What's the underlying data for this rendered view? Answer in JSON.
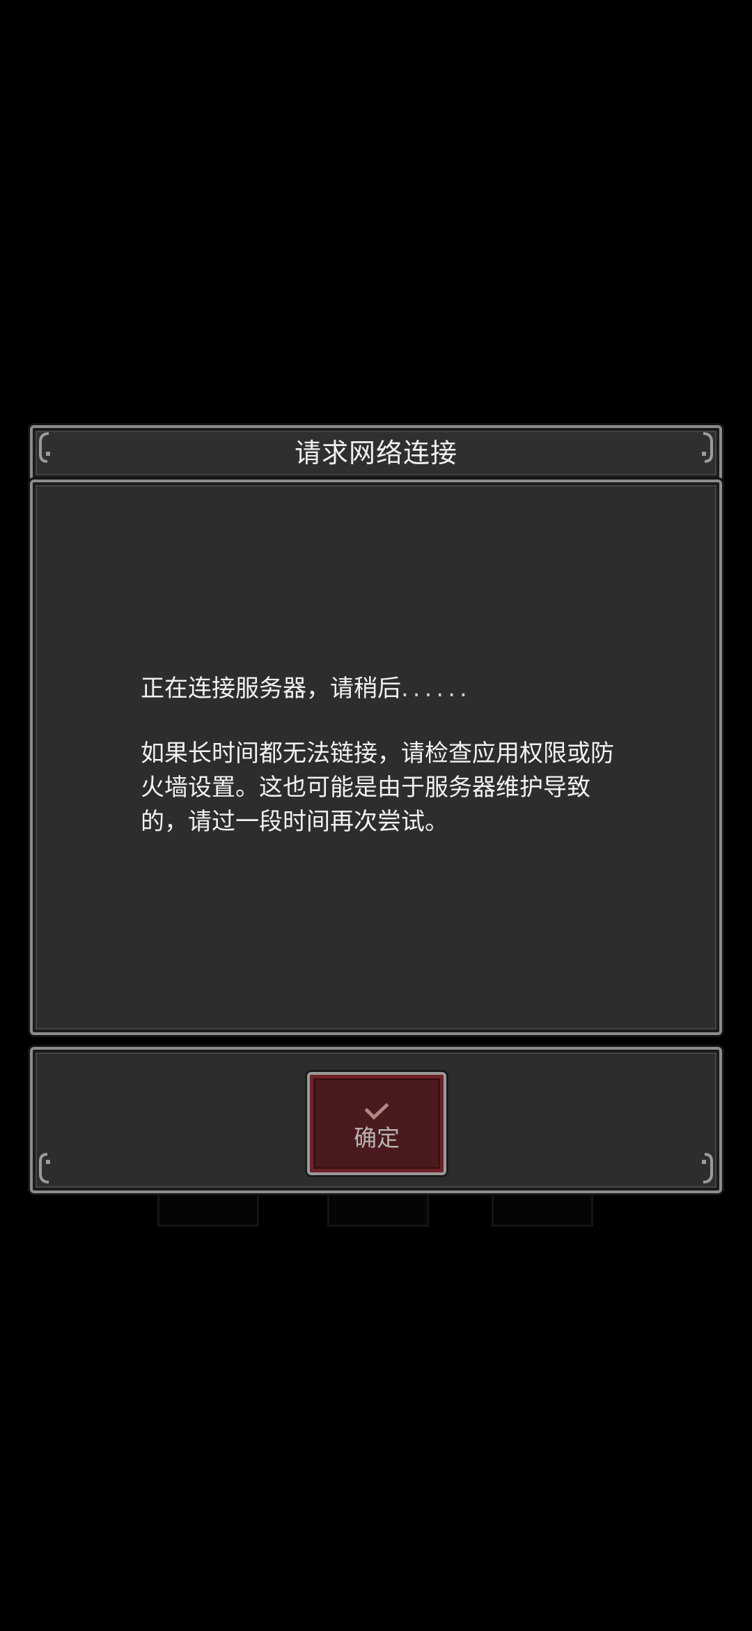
{
  "dialog": {
    "title": "请求网络连接",
    "status_text": "正在连接服务器，请稍后",
    "status_dots": "......",
    "detail_text": "如果长时间都无法链接，请检查应用权限或防火墙设置。这也可能是由于服务器维护导致的，请过一段时间再次尝试。",
    "confirm_label": "确定",
    "confirm_icon": "checkmark-icon"
  },
  "colors": {
    "background": "#000000",
    "panel": "#2d2d2d",
    "frame": "#8c8c8c",
    "button_fill": "#4a1a1e",
    "button_accent": "#6e2228",
    "text": "#f2f2f2"
  }
}
